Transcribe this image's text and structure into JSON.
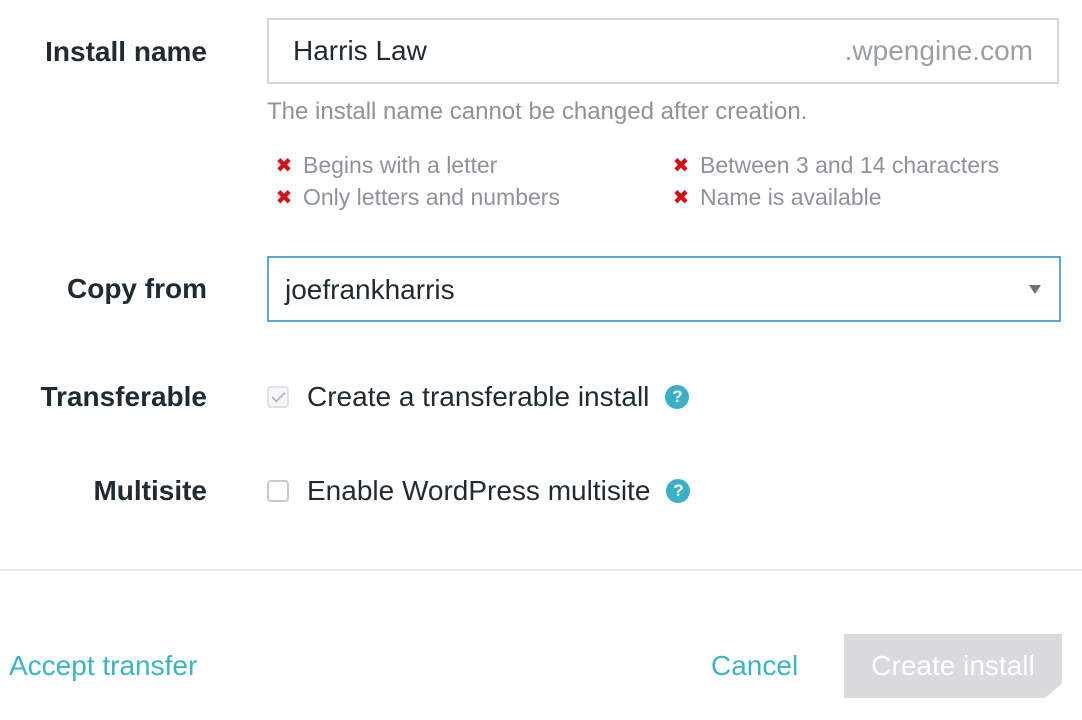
{
  "install_name": {
    "label": "Install name",
    "value": "Harris Law",
    "suffix": ".wpengine.com",
    "help": "The install name cannot be changed after creation.",
    "rules": [
      {
        "text": "Begins with a letter",
        "status": "invalid"
      },
      {
        "text": "Between 3 and 14 characters",
        "status": "invalid"
      },
      {
        "text": "Only letters and numbers",
        "status": "invalid"
      },
      {
        "text": "Name is available",
        "status": "invalid"
      }
    ]
  },
  "copy_from": {
    "label": "Copy from",
    "selected": "joefrankharris"
  },
  "transferable": {
    "label": "Transferable",
    "option": "Create a transferable install",
    "checked": true
  },
  "multisite": {
    "label": "Multisite",
    "option": "Enable WordPress multisite",
    "checked": false
  },
  "footer": {
    "accept_transfer": "Accept transfer",
    "cancel": "Cancel",
    "create": "Create install"
  },
  "icons": {
    "invalid": "x-icon",
    "help": "question-circle-icon",
    "dropdown": "chevron-down-icon"
  },
  "colors": {
    "accent": "#3bb4c4",
    "error": "#d0101b",
    "focus_border": "#5aa6d6",
    "disabled_button": "#d8dbdd"
  }
}
